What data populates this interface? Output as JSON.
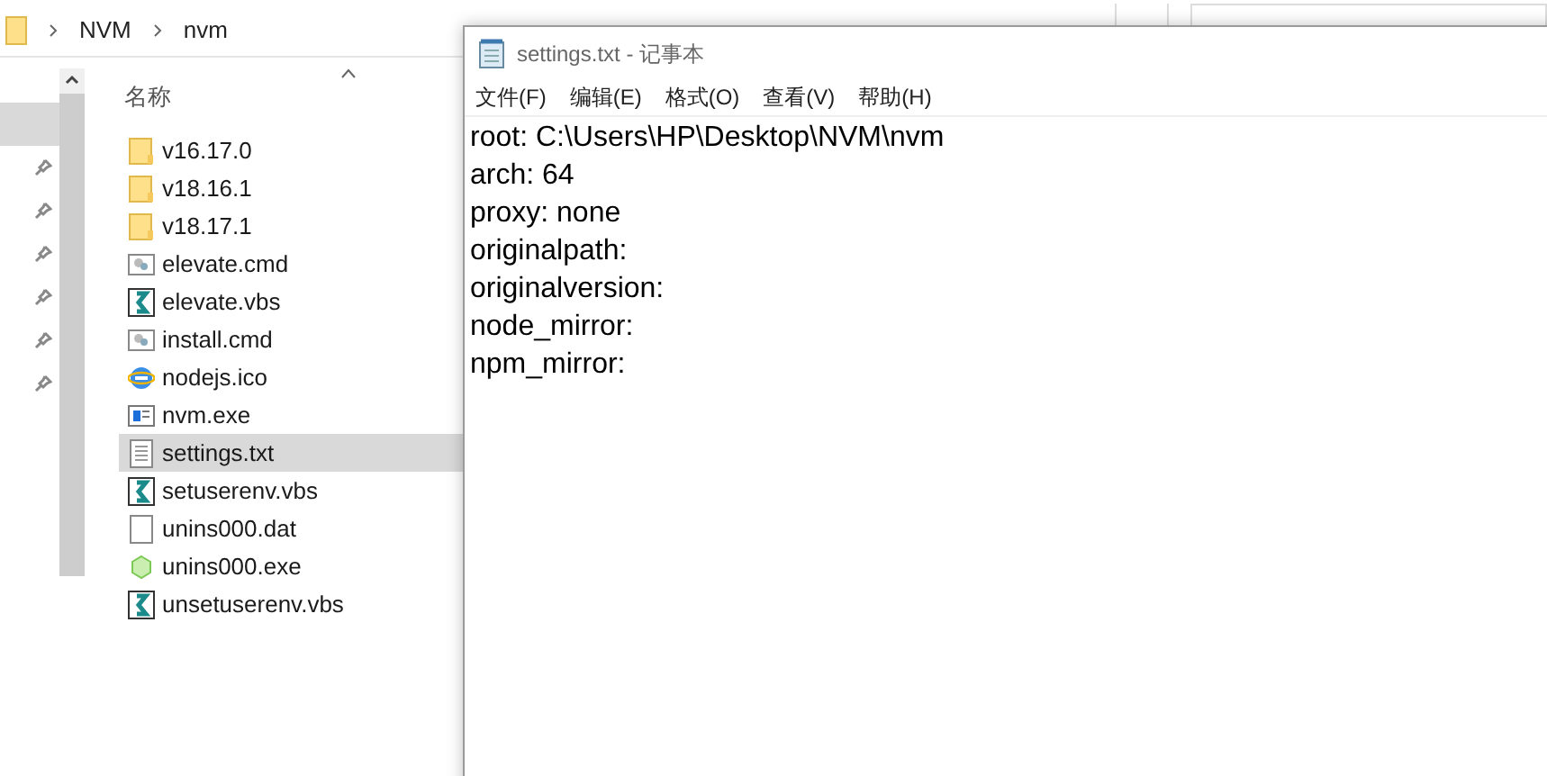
{
  "explorer": {
    "breadcrumb": [
      "NVM",
      "nvm"
    ],
    "nav_pins": [
      {
        "selected": true
      },
      {
        "selected": false
      },
      {
        "selected": false
      },
      {
        "selected": false
      },
      {
        "selected": false
      },
      {
        "selected": false
      },
      {
        "selected": false
      }
    ],
    "column_header": "名称",
    "files": [
      {
        "name": "v16.17.0",
        "kind": "folder",
        "selected": false
      },
      {
        "name": "v18.16.1",
        "kind": "folder",
        "selected": false
      },
      {
        "name": "v18.17.1",
        "kind": "folder",
        "selected": false
      },
      {
        "name": "elevate.cmd",
        "kind": "cmd",
        "selected": false
      },
      {
        "name": "elevate.vbs",
        "kind": "vbs",
        "selected": false
      },
      {
        "name": "install.cmd",
        "kind": "cmd",
        "selected": false
      },
      {
        "name": "nodejs.ico",
        "kind": "ie",
        "selected": false
      },
      {
        "name": "nvm.exe",
        "kind": "exe",
        "selected": false
      },
      {
        "name": "settings.txt",
        "kind": "txt",
        "selected": true
      },
      {
        "name": "setuserenv.vbs",
        "kind": "vbs",
        "selected": false
      },
      {
        "name": "unins000.dat",
        "kind": "blank",
        "selected": false
      },
      {
        "name": "unins000.exe",
        "kind": "node",
        "selected": false
      },
      {
        "name": "unsetuserenv.vbs",
        "kind": "vbs",
        "selected": false
      }
    ]
  },
  "notepad": {
    "title": "settings.txt - 记事本",
    "menu": [
      "文件(F)",
      "编辑(E)",
      "格式(O)",
      "查看(V)",
      "帮助(H)"
    ],
    "lines": [
      "root: C:\\Users\\HP\\Desktop\\NVM\\nvm",
      "arch: 64",
      "proxy: none",
      "originalpath:",
      "originalversion:",
      "node_mirror:",
      "npm_mirror:"
    ]
  }
}
